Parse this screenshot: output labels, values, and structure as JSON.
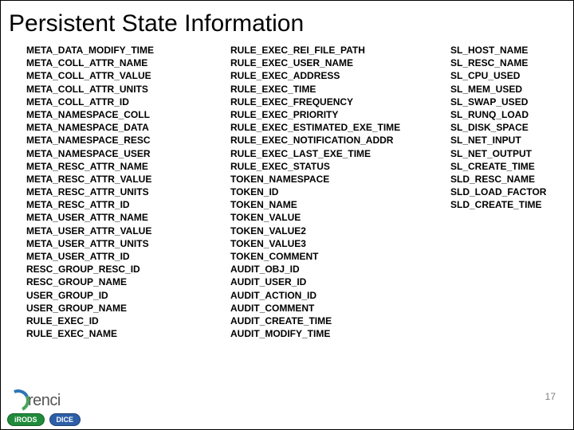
{
  "title": "Persistent State Information",
  "columns": [
    [
      "META_DATA_MODIFY_TIME",
      "META_COLL_ATTR_NAME",
      "META_COLL_ATTR_VALUE",
      "META_COLL_ATTR_UNITS",
      "META_COLL_ATTR_ID",
      "META_NAMESPACE_COLL",
      "META_NAMESPACE_DATA",
      "META_NAMESPACE_RESC",
      "META_NAMESPACE_USER",
      "META_RESC_ATTR_NAME",
      "META_RESC_ATTR_VALUE",
      "META_RESC_ATTR_UNITS",
      "META_RESC_ATTR_ID",
      "META_USER_ATTR_NAME",
      "META_USER_ATTR_VALUE",
      "META_USER_ATTR_UNITS",
      "META_USER_ATTR_ID",
      "RESC_GROUP_RESC_ID",
      "RESC_GROUP_NAME",
      "USER_GROUP_ID",
      "USER_GROUP_NAME",
      "RULE_EXEC_ID",
      "RULE_EXEC_NAME"
    ],
    [
      "RULE_EXEC_REI_FILE_PATH",
      "RULE_EXEC_USER_NAME",
      "RULE_EXEC_ADDRESS",
      "RULE_EXEC_TIME",
      "RULE_EXEC_FREQUENCY",
      "RULE_EXEC_PRIORITY",
      "RULE_EXEC_ESTIMATED_EXE_TIME",
      "RULE_EXEC_NOTIFICATION_ADDR",
      "RULE_EXEC_LAST_EXE_TIME",
      "RULE_EXEC_STATUS",
      "TOKEN_NAMESPACE",
      "TOKEN_ID",
      "TOKEN_NAME",
      "TOKEN_VALUE",
      "TOKEN_VALUE2",
      "TOKEN_VALUE3",
      "TOKEN_COMMENT",
      "AUDIT_OBJ_ID",
      "AUDIT_USER_ID",
      "AUDIT_ACTION_ID",
      "AUDIT_COMMENT",
      "AUDIT_CREATE_TIME",
      "AUDIT_MODIFY_TIME"
    ],
    [
      "SL_HOST_NAME",
      "SL_RESC_NAME",
      "SL_CPU_USED",
      "SL_MEM_USED",
      "SL_SWAP_USED",
      "SL_RUNQ_LOAD",
      "SL_DISK_SPACE",
      "SL_NET_INPUT",
      "SL_NET_OUTPUT",
      "SL_CREATE_TIME",
      "SLD_RESC_NAME",
      "SLD_LOAD_FACTOR",
      "SLD_CREATE_TIME"
    ]
  ],
  "page_number": "17",
  "logos": {
    "renci": "renci",
    "irods": "iRODS",
    "dice": "DICE"
  }
}
